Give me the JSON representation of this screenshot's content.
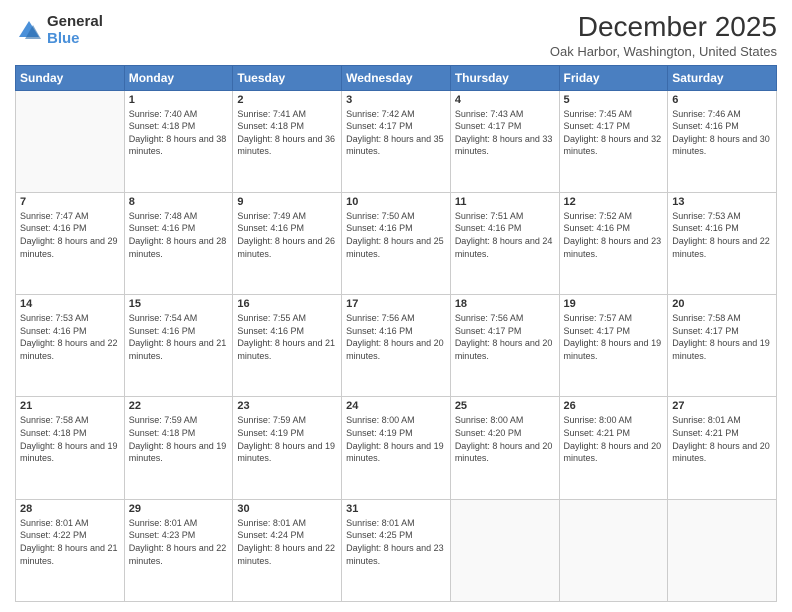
{
  "logo": {
    "general": "General",
    "blue": "Blue"
  },
  "header": {
    "title": "December 2025",
    "subtitle": "Oak Harbor, Washington, United States"
  },
  "days": [
    "Sunday",
    "Monday",
    "Tuesday",
    "Wednesday",
    "Thursday",
    "Friday",
    "Saturday"
  ],
  "weeks": [
    [
      {
        "day": "",
        "content": ""
      },
      {
        "day": "1",
        "sunrise": "Sunrise: 7:40 AM",
        "sunset": "Sunset: 4:18 PM",
        "daylight": "Daylight: 8 hours and 38 minutes."
      },
      {
        "day": "2",
        "sunrise": "Sunrise: 7:41 AM",
        "sunset": "Sunset: 4:18 PM",
        "daylight": "Daylight: 8 hours and 36 minutes."
      },
      {
        "day": "3",
        "sunrise": "Sunrise: 7:42 AM",
        "sunset": "Sunset: 4:17 PM",
        "daylight": "Daylight: 8 hours and 35 minutes."
      },
      {
        "day": "4",
        "sunrise": "Sunrise: 7:43 AM",
        "sunset": "Sunset: 4:17 PM",
        "daylight": "Daylight: 8 hours and 33 minutes."
      },
      {
        "day": "5",
        "sunrise": "Sunrise: 7:45 AM",
        "sunset": "Sunset: 4:17 PM",
        "daylight": "Daylight: 8 hours and 32 minutes."
      },
      {
        "day": "6",
        "sunrise": "Sunrise: 7:46 AM",
        "sunset": "Sunset: 4:16 PM",
        "daylight": "Daylight: 8 hours and 30 minutes."
      }
    ],
    [
      {
        "day": "7",
        "sunrise": "Sunrise: 7:47 AM",
        "sunset": "Sunset: 4:16 PM",
        "daylight": "Daylight: 8 hours and 29 minutes."
      },
      {
        "day": "8",
        "sunrise": "Sunrise: 7:48 AM",
        "sunset": "Sunset: 4:16 PM",
        "daylight": "Daylight: 8 hours and 28 minutes."
      },
      {
        "day": "9",
        "sunrise": "Sunrise: 7:49 AM",
        "sunset": "Sunset: 4:16 PM",
        "daylight": "Daylight: 8 hours and 26 minutes."
      },
      {
        "day": "10",
        "sunrise": "Sunrise: 7:50 AM",
        "sunset": "Sunset: 4:16 PM",
        "daylight": "Daylight: 8 hours and 25 minutes."
      },
      {
        "day": "11",
        "sunrise": "Sunrise: 7:51 AM",
        "sunset": "Sunset: 4:16 PM",
        "daylight": "Daylight: 8 hours and 24 minutes."
      },
      {
        "day": "12",
        "sunrise": "Sunrise: 7:52 AM",
        "sunset": "Sunset: 4:16 PM",
        "daylight": "Daylight: 8 hours and 23 minutes."
      },
      {
        "day": "13",
        "sunrise": "Sunrise: 7:53 AM",
        "sunset": "Sunset: 4:16 PM",
        "daylight": "Daylight: 8 hours and 22 minutes."
      }
    ],
    [
      {
        "day": "14",
        "sunrise": "Sunrise: 7:53 AM",
        "sunset": "Sunset: 4:16 PM",
        "daylight": "Daylight: 8 hours and 22 minutes."
      },
      {
        "day": "15",
        "sunrise": "Sunrise: 7:54 AM",
        "sunset": "Sunset: 4:16 PM",
        "daylight": "Daylight: 8 hours and 21 minutes."
      },
      {
        "day": "16",
        "sunrise": "Sunrise: 7:55 AM",
        "sunset": "Sunset: 4:16 PM",
        "daylight": "Daylight: 8 hours and 21 minutes."
      },
      {
        "day": "17",
        "sunrise": "Sunrise: 7:56 AM",
        "sunset": "Sunset: 4:16 PM",
        "daylight": "Daylight: 8 hours and 20 minutes."
      },
      {
        "day": "18",
        "sunrise": "Sunrise: 7:56 AM",
        "sunset": "Sunset: 4:17 PM",
        "daylight": "Daylight: 8 hours and 20 minutes."
      },
      {
        "day": "19",
        "sunrise": "Sunrise: 7:57 AM",
        "sunset": "Sunset: 4:17 PM",
        "daylight": "Daylight: 8 hours and 19 minutes."
      },
      {
        "day": "20",
        "sunrise": "Sunrise: 7:58 AM",
        "sunset": "Sunset: 4:17 PM",
        "daylight": "Daylight: 8 hours and 19 minutes."
      }
    ],
    [
      {
        "day": "21",
        "sunrise": "Sunrise: 7:58 AM",
        "sunset": "Sunset: 4:18 PM",
        "daylight": "Daylight: 8 hours and 19 minutes."
      },
      {
        "day": "22",
        "sunrise": "Sunrise: 7:59 AM",
        "sunset": "Sunset: 4:18 PM",
        "daylight": "Daylight: 8 hours and 19 minutes."
      },
      {
        "day": "23",
        "sunrise": "Sunrise: 7:59 AM",
        "sunset": "Sunset: 4:19 PM",
        "daylight": "Daylight: 8 hours and 19 minutes."
      },
      {
        "day": "24",
        "sunrise": "Sunrise: 8:00 AM",
        "sunset": "Sunset: 4:19 PM",
        "daylight": "Daylight: 8 hours and 19 minutes."
      },
      {
        "day": "25",
        "sunrise": "Sunrise: 8:00 AM",
        "sunset": "Sunset: 4:20 PM",
        "daylight": "Daylight: 8 hours and 20 minutes."
      },
      {
        "day": "26",
        "sunrise": "Sunrise: 8:00 AM",
        "sunset": "Sunset: 4:21 PM",
        "daylight": "Daylight: 8 hours and 20 minutes."
      },
      {
        "day": "27",
        "sunrise": "Sunrise: 8:01 AM",
        "sunset": "Sunset: 4:21 PM",
        "daylight": "Daylight: 8 hours and 20 minutes."
      }
    ],
    [
      {
        "day": "28",
        "sunrise": "Sunrise: 8:01 AM",
        "sunset": "Sunset: 4:22 PM",
        "daylight": "Daylight: 8 hours and 21 minutes."
      },
      {
        "day": "29",
        "sunrise": "Sunrise: 8:01 AM",
        "sunset": "Sunset: 4:23 PM",
        "daylight": "Daylight: 8 hours and 22 minutes."
      },
      {
        "day": "30",
        "sunrise": "Sunrise: 8:01 AM",
        "sunset": "Sunset: 4:24 PM",
        "daylight": "Daylight: 8 hours and 22 minutes."
      },
      {
        "day": "31",
        "sunrise": "Sunrise: 8:01 AM",
        "sunset": "Sunset: 4:25 PM",
        "daylight": "Daylight: 8 hours and 23 minutes."
      },
      {
        "day": "",
        "content": ""
      },
      {
        "day": "",
        "content": ""
      },
      {
        "day": "",
        "content": ""
      }
    ]
  ]
}
